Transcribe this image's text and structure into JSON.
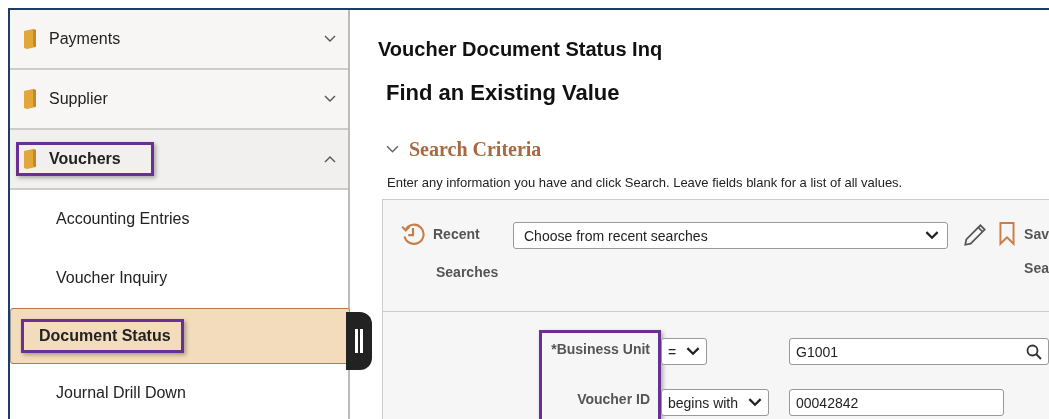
{
  "sidebar": {
    "items": [
      {
        "label": "Payments",
        "expanded": false,
        "highlighted": false
      },
      {
        "label": "Supplier",
        "expanded": false,
        "highlighted": false
      },
      {
        "label": "Vouchers",
        "expanded": true,
        "highlighted": true,
        "children": [
          {
            "label": "Accounting Entries",
            "selected": false,
            "highlighted": false
          },
          {
            "label": "Voucher Inquiry",
            "selected": false,
            "highlighted": false
          },
          {
            "label": "Document Status",
            "selected": true,
            "highlighted": true
          },
          {
            "label": "Journal Drill Down",
            "selected": false,
            "highlighted": false
          }
        ]
      }
    ]
  },
  "page": {
    "title": "Voucher Document Status Inq",
    "subtitle": "Find an Existing Value"
  },
  "search_criteria": {
    "heading": "Search Criteria",
    "expanded": true,
    "instructions": "Enter any information you have and click Search. Leave fields blank for a list of all values.",
    "recent": {
      "label_1": "Recent",
      "label_2": "Searches",
      "value": "Choose from recent searches"
    },
    "save": {
      "label_1": "Sav",
      "label_2": "Sea"
    },
    "labels_highlighted": true,
    "fields": [
      {
        "label": "*Business Unit",
        "operator": "=",
        "value": "G1001",
        "lookup": true
      },
      {
        "label": "Voucher ID",
        "operator": "begins with",
        "value": "00042842",
        "lookup": false
      }
    ]
  }
}
